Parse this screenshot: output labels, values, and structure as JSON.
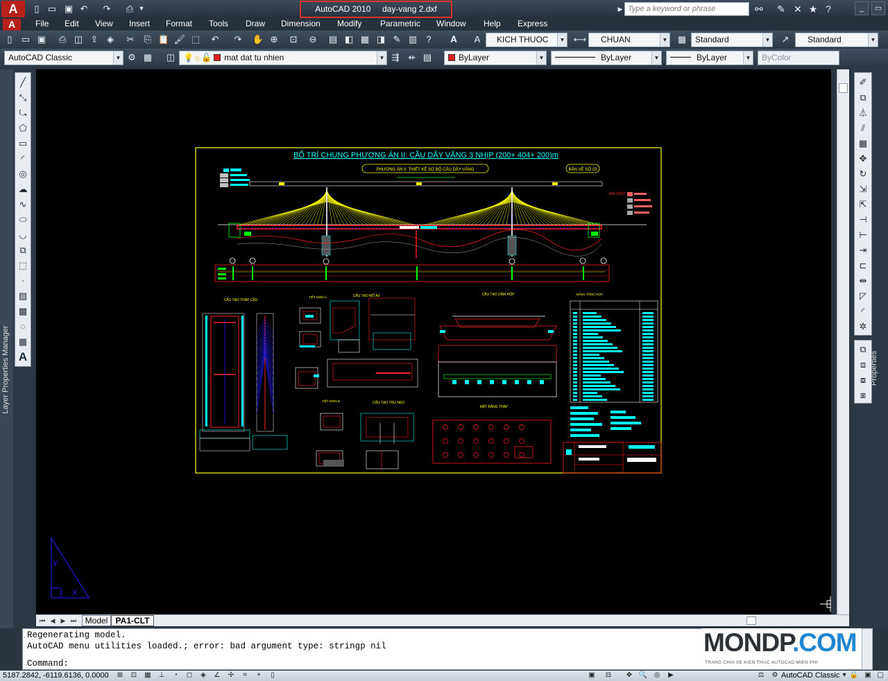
{
  "app": {
    "name": "AutoCAD 2010",
    "file": "day-vang 2.dxf",
    "logo": "A"
  },
  "search": {
    "placeholder": "Type a keyword or phrase"
  },
  "menu": [
    "File",
    "Edit",
    "View",
    "Insert",
    "Format",
    "Tools",
    "Draw",
    "Dimension",
    "Modify",
    "Parametric",
    "Window",
    "Help",
    "Express"
  ],
  "styles": {
    "text_style": "KICH THUOC",
    "dim_style": "CHUAN",
    "table_style": "Standard",
    "multileader_style": "Standard"
  },
  "workspace": {
    "combo": "AutoCAD Classic",
    "status": "AutoCAD Classic"
  },
  "layer": {
    "current": "mat dat tu nhien",
    "color": "#e02020"
  },
  "properties": {
    "color": "ByLayer",
    "color_swatch": "#e02020",
    "linetype": "ByLayer",
    "lineweight": "ByLayer",
    "plotstyle": "ByColor"
  },
  "palettes": {
    "left_label": "Layer Properties Manager",
    "right_label": "Properties"
  },
  "layout_tabs": {
    "model": "Model",
    "layout1": "PA1-CLT"
  },
  "command": {
    "lines": [
      "Regenerating model.",
      "AutoCAD menu utilities loaded.; error: bad argument type: stringp nil"
    ],
    "prompt": "Command:"
  },
  "status": {
    "coords": "5187.2842, -6119.6136, 0.0000"
  },
  "watermark": {
    "brand_part1": "MONDP",
    "brand_part2": ".COM",
    "tagline": "TRANG CHIA SE KIEN THUC AUTOCAD MIEN PHI"
  },
  "drawing": {
    "title": "BỐ TRÍ CHUNG PHƯƠNG ÁN II: CẦU DÂY VĂNG 3 NHỊP (200+ 404+ 200)m",
    "subtitle": "PHƯƠNG ÁN II: THIẾT KẾ SƠ BỘ CẦU DÂY VĂNG",
    "sheet_no": "BẢN VẼ SỐ 03",
    "sections": [
      "CẤU TẠO THÁP CẦU",
      "CẤU TẠO MỐ A0",
      "CẤU TẠO DẦM HỘP",
      "CẤU TẠO TRỤ NEO",
      "MẶT BẰNG THÁP",
      "BẢNG TỔNG HỢP"
    ],
    "soil_label": "ĐỊA CHẤT",
    "colors": {
      "frame": "#ffff00",
      "cables": "#ffff00",
      "deck": "#ff2020",
      "dims": "#00ffff",
      "ground": "#00ff00",
      "ucs": "#2020ff"
    }
  }
}
